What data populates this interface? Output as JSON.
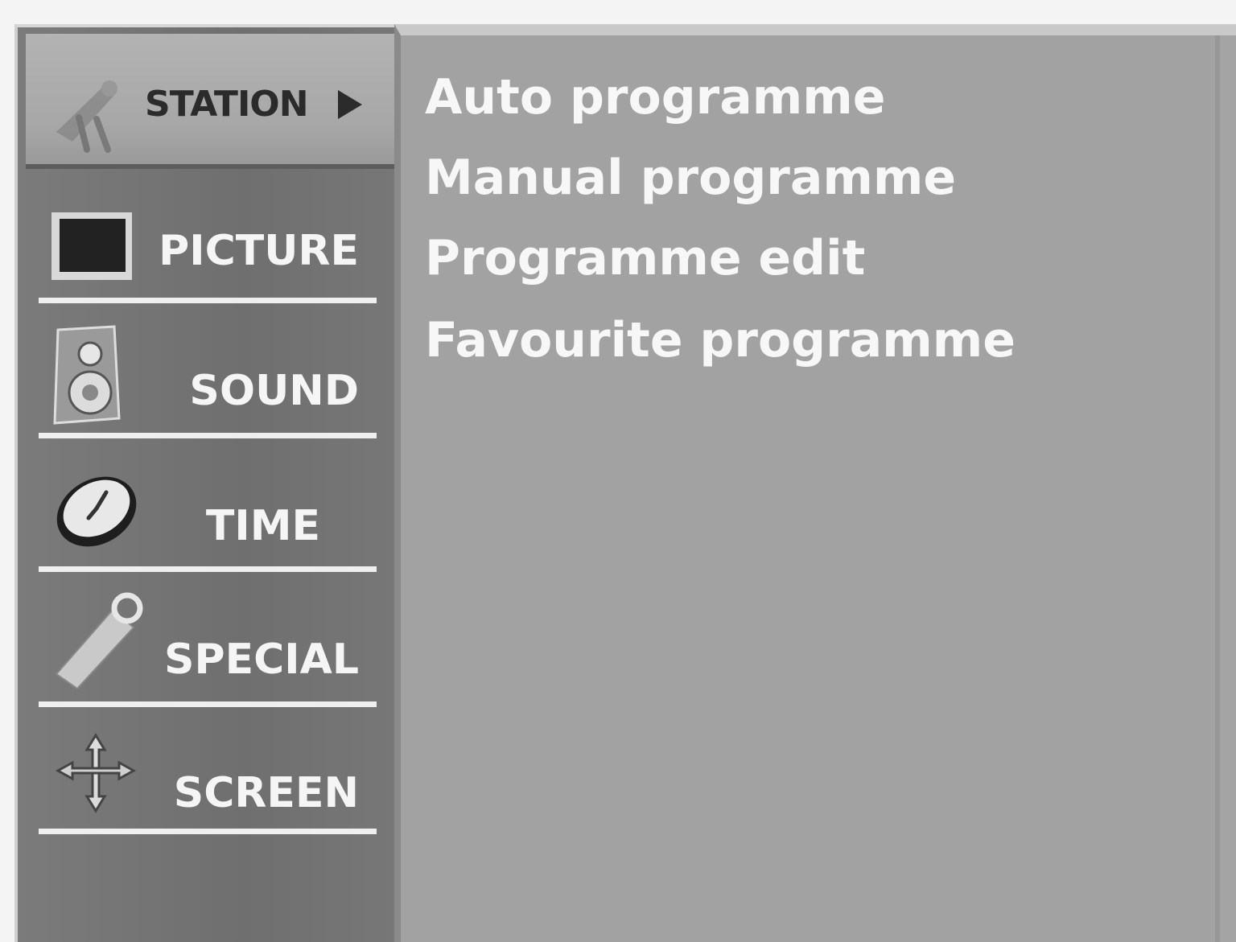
{
  "nav": {
    "active": {
      "label": "STATION",
      "icon": "antenna-icon"
    },
    "items": [
      {
        "label": "PICTURE",
        "icon": "picture-icon"
      },
      {
        "label": "SOUND",
        "icon": "speaker-icon"
      },
      {
        "label": "TIME",
        "icon": "clock-icon"
      },
      {
        "label": "SPECIAL",
        "icon": "tag-icon"
      },
      {
        "label": "SCREEN",
        "icon": "move-arrows-icon"
      }
    ]
  },
  "submenu": {
    "options": [
      "Auto programme",
      "Manual programme",
      "Programme edit",
      "Favourite programme"
    ]
  },
  "colors": {
    "panel_gray": "#a4a4a4",
    "nav_gray": "#747474",
    "text_light": "#f5f5f5"
  }
}
